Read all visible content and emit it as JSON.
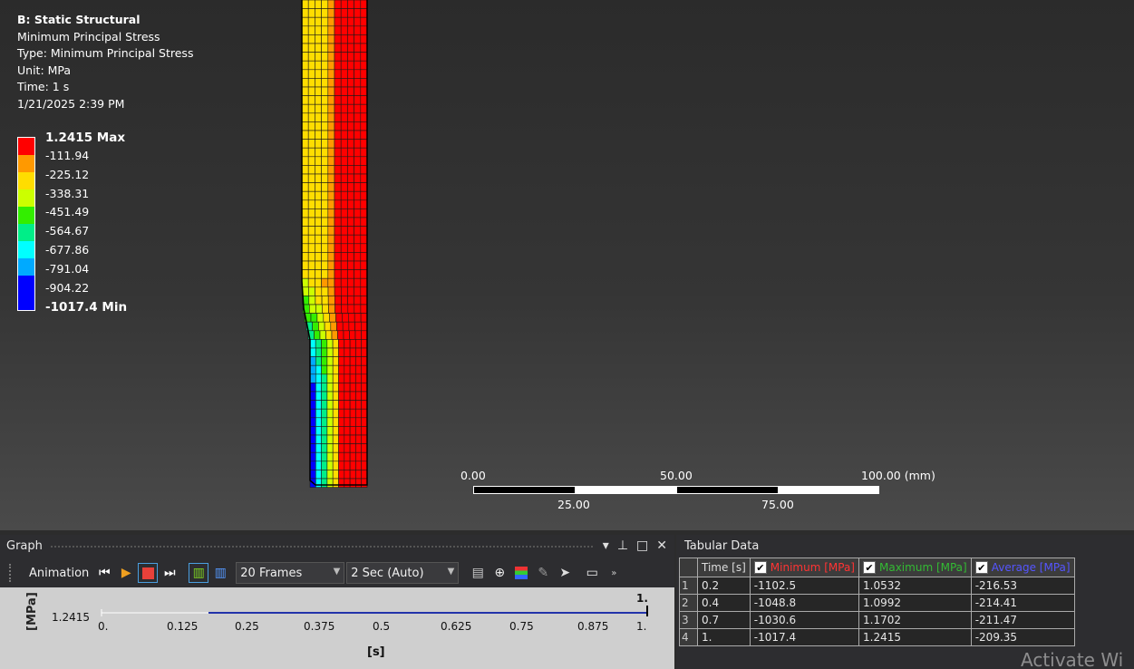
{
  "info": {
    "title": "B: Static Structural",
    "result": "Minimum Principal Stress",
    "type": "Type: Minimum Principal Stress",
    "unit": "Unit: MPa",
    "time": "Time: 1 s",
    "date": "1/21/2025 2:39 PM"
  },
  "legend": {
    "colors": [
      "#ff0000",
      "#ff9900",
      "#ffdd00",
      "#ccff00",
      "#33ee00",
      "#00ee88",
      "#00ffff",
      "#00aaff",
      "#0000ff"
    ],
    "labels": [
      "1.2415 Max",
      "-111.94",
      "-225.12",
      "-338.31",
      "-451.49",
      "-564.67",
      "-677.86",
      "-791.04",
      "-904.22",
      "-1017.4 Min"
    ]
  },
  "scale_bar": {
    "labels_top": [
      "0.00",
      "50.00",
      "100.00 (mm)"
    ],
    "labels_bottom": [
      "25.00",
      "75.00"
    ]
  },
  "graph": {
    "title": "Graph",
    "animation_label": "Animation",
    "frames": "20 Frames",
    "duration": "2 Sec (Auto)",
    "y_unit": "[MPa]",
    "y_value": "1.2415",
    "x_ticks": [
      "0.",
      "0.125",
      "0.25",
      "0.375",
      "0.5",
      "0.625",
      "0.75",
      "0.875",
      "1."
    ],
    "x_unit": "[s]",
    "marker_label": "1."
  },
  "tabular": {
    "title": "Tabular Data",
    "headers": [
      "Time [s]",
      "Minimum [MPa]",
      "Maximum [MPa]",
      "Average [MPa]"
    ],
    "header_colors": [
      "#dddddd",
      "#ff3333",
      "#33bb33",
      "#5555ff"
    ],
    "rows": [
      [
        "1",
        "0.2",
        "-1102.5",
        "1.0532",
        "-216.53"
      ],
      [
        "2",
        "0.4",
        "-1048.8",
        "1.0992",
        "-214.41"
      ],
      [
        "3",
        "0.7",
        "-1030.6",
        "1.1702",
        "-211.47"
      ],
      [
        "4",
        "1.",
        "-1017.4",
        "1.2415",
        "-209.35"
      ]
    ]
  },
  "watermark": "Activate Wi"
}
